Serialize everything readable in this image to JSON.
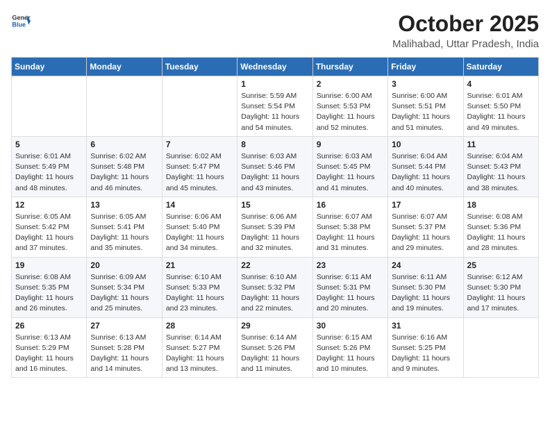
{
  "header": {
    "logo_general": "General",
    "logo_blue": "Blue",
    "month": "October 2025",
    "location": "Malihabad, Uttar Pradesh, India"
  },
  "weekdays": [
    "Sunday",
    "Monday",
    "Tuesday",
    "Wednesday",
    "Thursday",
    "Friday",
    "Saturday"
  ],
  "weeks": [
    [
      {
        "day": "",
        "info": ""
      },
      {
        "day": "",
        "info": ""
      },
      {
        "day": "",
        "info": ""
      },
      {
        "day": "1",
        "info": "Sunrise: 5:59 AM\nSunset: 5:54 PM\nDaylight: 11 hours\nand 54 minutes."
      },
      {
        "day": "2",
        "info": "Sunrise: 6:00 AM\nSunset: 5:53 PM\nDaylight: 11 hours\nand 52 minutes."
      },
      {
        "day": "3",
        "info": "Sunrise: 6:00 AM\nSunset: 5:51 PM\nDaylight: 11 hours\nand 51 minutes."
      },
      {
        "day": "4",
        "info": "Sunrise: 6:01 AM\nSunset: 5:50 PM\nDaylight: 11 hours\nand 49 minutes."
      }
    ],
    [
      {
        "day": "5",
        "info": "Sunrise: 6:01 AM\nSunset: 5:49 PM\nDaylight: 11 hours\nand 48 minutes."
      },
      {
        "day": "6",
        "info": "Sunrise: 6:02 AM\nSunset: 5:48 PM\nDaylight: 11 hours\nand 46 minutes."
      },
      {
        "day": "7",
        "info": "Sunrise: 6:02 AM\nSunset: 5:47 PM\nDaylight: 11 hours\nand 45 minutes."
      },
      {
        "day": "8",
        "info": "Sunrise: 6:03 AM\nSunset: 5:46 PM\nDaylight: 11 hours\nand 43 minutes."
      },
      {
        "day": "9",
        "info": "Sunrise: 6:03 AM\nSunset: 5:45 PM\nDaylight: 11 hours\nand 41 minutes."
      },
      {
        "day": "10",
        "info": "Sunrise: 6:04 AM\nSunset: 5:44 PM\nDaylight: 11 hours\nand 40 minutes."
      },
      {
        "day": "11",
        "info": "Sunrise: 6:04 AM\nSunset: 5:43 PM\nDaylight: 11 hours\nand 38 minutes."
      }
    ],
    [
      {
        "day": "12",
        "info": "Sunrise: 6:05 AM\nSunset: 5:42 PM\nDaylight: 11 hours\nand 37 minutes."
      },
      {
        "day": "13",
        "info": "Sunrise: 6:05 AM\nSunset: 5:41 PM\nDaylight: 11 hours\nand 35 minutes."
      },
      {
        "day": "14",
        "info": "Sunrise: 6:06 AM\nSunset: 5:40 PM\nDaylight: 11 hours\nand 34 minutes."
      },
      {
        "day": "15",
        "info": "Sunrise: 6:06 AM\nSunset: 5:39 PM\nDaylight: 11 hours\nand 32 minutes."
      },
      {
        "day": "16",
        "info": "Sunrise: 6:07 AM\nSunset: 5:38 PM\nDaylight: 11 hours\nand 31 minutes."
      },
      {
        "day": "17",
        "info": "Sunrise: 6:07 AM\nSunset: 5:37 PM\nDaylight: 11 hours\nand 29 minutes."
      },
      {
        "day": "18",
        "info": "Sunrise: 6:08 AM\nSunset: 5:36 PM\nDaylight: 11 hours\nand 28 minutes."
      }
    ],
    [
      {
        "day": "19",
        "info": "Sunrise: 6:08 AM\nSunset: 5:35 PM\nDaylight: 11 hours\nand 26 minutes."
      },
      {
        "day": "20",
        "info": "Sunrise: 6:09 AM\nSunset: 5:34 PM\nDaylight: 11 hours\nand 25 minutes."
      },
      {
        "day": "21",
        "info": "Sunrise: 6:10 AM\nSunset: 5:33 PM\nDaylight: 11 hours\nand 23 minutes."
      },
      {
        "day": "22",
        "info": "Sunrise: 6:10 AM\nSunset: 5:32 PM\nDaylight: 11 hours\nand 22 minutes."
      },
      {
        "day": "23",
        "info": "Sunrise: 6:11 AM\nSunset: 5:31 PM\nDaylight: 11 hours\nand 20 minutes."
      },
      {
        "day": "24",
        "info": "Sunrise: 6:11 AM\nSunset: 5:30 PM\nDaylight: 11 hours\nand 19 minutes."
      },
      {
        "day": "25",
        "info": "Sunrise: 6:12 AM\nSunset: 5:30 PM\nDaylight: 11 hours\nand 17 minutes."
      }
    ],
    [
      {
        "day": "26",
        "info": "Sunrise: 6:13 AM\nSunset: 5:29 PM\nDaylight: 11 hours\nand 16 minutes."
      },
      {
        "day": "27",
        "info": "Sunrise: 6:13 AM\nSunset: 5:28 PM\nDaylight: 11 hours\nand 14 minutes."
      },
      {
        "day": "28",
        "info": "Sunrise: 6:14 AM\nSunset: 5:27 PM\nDaylight: 11 hours\nand 13 minutes."
      },
      {
        "day": "29",
        "info": "Sunrise: 6:14 AM\nSunset: 5:26 PM\nDaylight: 11 hours\nand 11 minutes."
      },
      {
        "day": "30",
        "info": "Sunrise: 6:15 AM\nSunset: 5:26 PM\nDaylight: 11 hours\nand 10 minutes."
      },
      {
        "day": "31",
        "info": "Sunrise: 6:16 AM\nSunset: 5:25 PM\nDaylight: 11 hours\nand 9 minutes."
      },
      {
        "day": "",
        "info": ""
      }
    ]
  ]
}
